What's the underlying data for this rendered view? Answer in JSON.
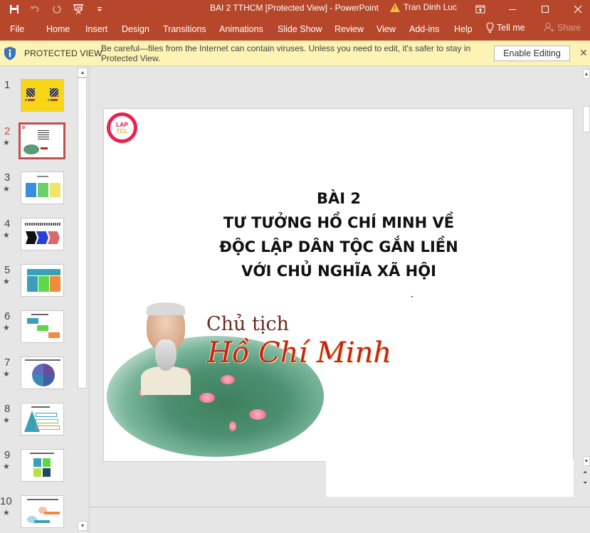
{
  "window": {
    "title": "BAI 2 TTHCM [Protected View]  -  PowerPoint",
    "user_name": "Tran Dinh Luc",
    "warning_icon": "warning-triangle-icon",
    "controls": [
      "ribbon-display-options",
      "minimize",
      "maximize",
      "close"
    ]
  },
  "quick_access": {
    "items": [
      {
        "name": "save",
        "icon": "save-icon"
      },
      {
        "name": "undo",
        "icon": "undo-icon"
      },
      {
        "name": "redo",
        "icon": "redo-icon"
      },
      {
        "name": "start-from-beginning",
        "icon": "presenter-icon"
      },
      {
        "name": "customize",
        "icon": "customize-qat-icon"
      }
    ]
  },
  "ribbon": {
    "tabs": [
      {
        "label": "File"
      },
      {
        "label": "Home"
      },
      {
        "label": "Insert"
      },
      {
        "label": "Design"
      },
      {
        "label": "Transitions"
      },
      {
        "label": "Animations"
      },
      {
        "label": "Slide Show"
      },
      {
        "label": "Review"
      },
      {
        "label": "View"
      },
      {
        "label": "Add-ins"
      },
      {
        "label": "Help"
      },
      {
        "label": "Tell me"
      },
      {
        "label": "Share"
      }
    ]
  },
  "protected_view": {
    "label": "PROTECTED VIEW",
    "message": "Be careful—files from the Internet can contain viruses. Unless you need to edit, it's safer to stay in Protected View.",
    "button": "Enable Editing",
    "close": "✕"
  },
  "thumbnails": {
    "selected": 2,
    "items": [
      {
        "number": "1",
        "star": false
      },
      {
        "number": "2",
        "star": true
      },
      {
        "number": "3",
        "star": true
      },
      {
        "number": "4",
        "star": true
      },
      {
        "number": "5",
        "star": true
      },
      {
        "number": "6",
        "star": true
      },
      {
        "number": "7",
        "star": true
      },
      {
        "number": "8",
        "star": true
      },
      {
        "number": "9",
        "star": true
      },
      {
        "number": "10",
        "star": true
      }
    ],
    "star_glyph": "★"
  },
  "slide": {
    "logo_line1": "LAP",
    "logo_line2": "TCL",
    "title_lines": [
      "BÀI 2",
      "TƯ TƯỞNG HỒ CHÍ MINH VỀ",
      "ĐỘC LẬP DÂN TỘC GẮN LIỀN",
      "VỚI CHỦ NGHĨA XÃ HỘI"
    ],
    "image_caption_line1": "Chủ tịch",
    "image_caption_line2": "Hồ Chí Minh"
  },
  "colors": {
    "accent": "#b7472a",
    "protected_bar": "#fcf3b4",
    "selected_thumb_border": "#c0504d"
  }
}
